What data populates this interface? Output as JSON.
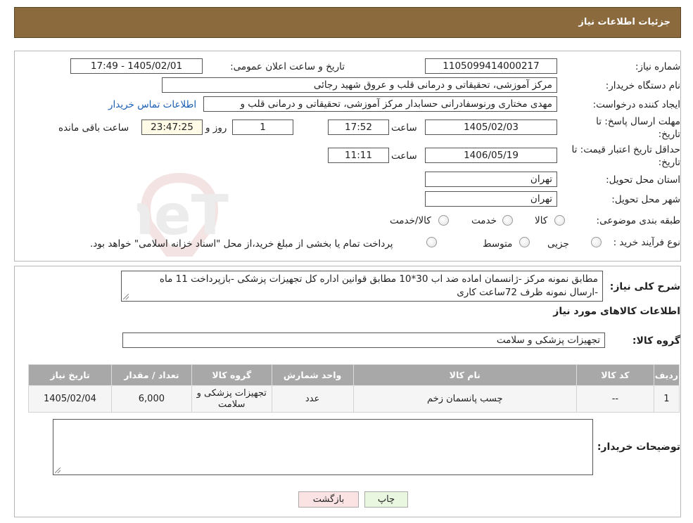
{
  "header": {
    "title": "جزئیات اطلاعات نیاز"
  },
  "form": {
    "need_number": {
      "label": "شماره نیاز:",
      "value": "1105099414000217"
    },
    "announce": {
      "label": "تاریخ و ساعت اعلان عمومی:",
      "value": "1405/02/01 - 17:49"
    },
    "buyer": {
      "label": "نام دستگاه خریدار:",
      "value": "مرکز آموزشی، تحقیقاتی و درمانی قلب و عروق شهید رجائی"
    },
    "creator": {
      "label": "ایجاد کننده درخواست:",
      "value": "مهدی مختاری ورنوسفادرانی حسابدار مرکز آموزشی، تحقیقاتی و درمانی قلب و",
      "contact_link": "اطلاعات تماس خریدار"
    },
    "deadline": {
      "label_line1": "مهلت ارسال پاسخ: تا",
      "label_line2": "تاریخ:",
      "date": "1405/02/03",
      "time_label": "ساعت",
      "time": "17:52",
      "days": "1",
      "days_label": "روز و",
      "remaining": "23:47:25",
      "remaining_label": "ساعت باقی مانده"
    },
    "validity": {
      "label_line1": "حداقل تاریخ اعتبار قیمت: تا",
      "label_line2": "تاریخ:",
      "date": "1406/05/19",
      "time_label": "ساعت",
      "time": "11:11"
    },
    "province": {
      "label": "استان محل تحویل:",
      "value": "تهران"
    },
    "city": {
      "label": "شهر محل تحویل:",
      "value": "تهران"
    },
    "category": {
      "label": "طبقه بندی موضوعی:",
      "options": [
        "کالا",
        "خدمت",
        "کالا/خدمت"
      ]
    },
    "process": {
      "label": "نوع فرآیند خرید :",
      "options": [
        "جزیی",
        "متوسط"
      ],
      "note": "پرداخت تمام یا بخشی از مبلغ خرید،از محل \"اسناد خزانه اسلامی\" خواهد بود."
    }
  },
  "watermark": {
    "text": "AriaTender.neT"
  },
  "description": {
    "label": "شرح کلی نیاز:",
    "line1": "مطابق نمونه مرکز -ژانسمان اماده ضد اب 30*10 مطابق قوانین اداره کل تجهیزات پزشکی -بازپرداخت 11 ماه",
    "line2": "-ارسال نمونه ظرف 72ساعت کاری"
  },
  "goods_section": {
    "title": "اطلاعات کالاهای مورد نیاز",
    "group_label": "گروه کالا:",
    "group_value": "تجهیزات پزشکی و سلامت"
  },
  "table": {
    "headers": [
      "ردیف",
      "کد کالا",
      "نام کالا",
      "واحد شمارش",
      "گروه کالا",
      "تعداد / مقدار",
      "تاریخ نیاز"
    ],
    "rows": [
      [
        "1",
        "--",
        "چسب پانسمان زخم",
        "عدد",
        "تجهیزات پزشکی و سلامت",
        "6,000",
        "1405/02/04"
      ]
    ]
  },
  "buyer_notes": {
    "label": "توضیحات خریدار:",
    "value": ""
  },
  "buttons": {
    "print": "چاپ",
    "back": "بازگشت"
  },
  "colors": {
    "header_bg": "#8b6a3e",
    "table_header_bg": "#a8a8a8",
    "print_btn": "#eaf7e0",
    "back_btn": "#fbe3e3"
  }
}
